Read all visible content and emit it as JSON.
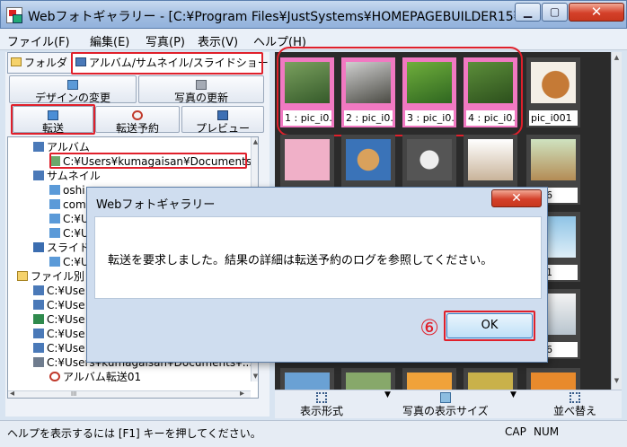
{
  "window": {
    "title": "Webフォトギャラリー - [C:¥Program Files¥JustSystems¥HOMEPAGEBUILDER15¥...",
    "min": "▁",
    "max": "▢",
    "close": "✕"
  },
  "menu": [
    "ファイル(F)",
    "編集(E)",
    "写真(P)",
    "表示(V)",
    "ヘルプ(H)"
  ],
  "tabs": {
    "folder": "フォルダ",
    "album": "アルバム/サムネイル/スライドショー"
  },
  "toolbar": {
    "design": "デザインの変更",
    "photo_update": "写真の更新",
    "transfer": "転送",
    "schedule": "転送予約",
    "preview": "プレビュー"
  },
  "tree": {
    "album": "アルバム",
    "album_path": "C:¥Users¥kumagaisan¥Documents",
    "thumbnail": "サムネイル",
    "thumb_items": [
      "oshi",
      "com",
      "C:¥U",
      "C:¥U"
    ],
    "thumb_clipped": "...........",
    "slide": "スライド",
    "slide_item": "C:¥U",
    "by_file": "ファイル別",
    "file_items": [
      "C:¥Use",
      "C:¥Use",
      "C:¥Use",
      "C:¥Use",
      "C:¥Use",
      "C:¥Users¥kumagaisan¥Documents¥..."
    ],
    "album_transfer": "アルバム転送01",
    "scroll_up": "▲",
    "scroll_down": "▼",
    "scroll_left": "◂",
    "scroll_right": "▸",
    "hscroll_grip": "III"
  },
  "gallery": {
    "captions": [
      "1 : pic_i0...",
      "2 : pic_i0...",
      "3 : pic_i0...",
      "4 : pic_i0...",
      "pic_i001",
      "i006",
      "i011",
      "i016"
    ],
    "scroll_up": "▲",
    "scroll_down": "▼"
  },
  "bottom_toolbar": {
    "view_format": "表示形式",
    "photo_size": "写真の表示サイズ",
    "sort": "並べ替え",
    "dropdown": "▼"
  },
  "status": {
    "help": "ヘルプを表示するには [F1] キーを押してください。",
    "cap": "CAP",
    "num": "NUM"
  },
  "dialog": {
    "title": "Webフォトギャラリー",
    "message": "転送を要求しました。結果の詳細は転送予約のログを参照してください。",
    "ok": "OK",
    "step": "⑥",
    "close": "✕"
  },
  "colors": {
    "highlight": "#e0202b",
    "selected": "#f179c2"
  }
}
